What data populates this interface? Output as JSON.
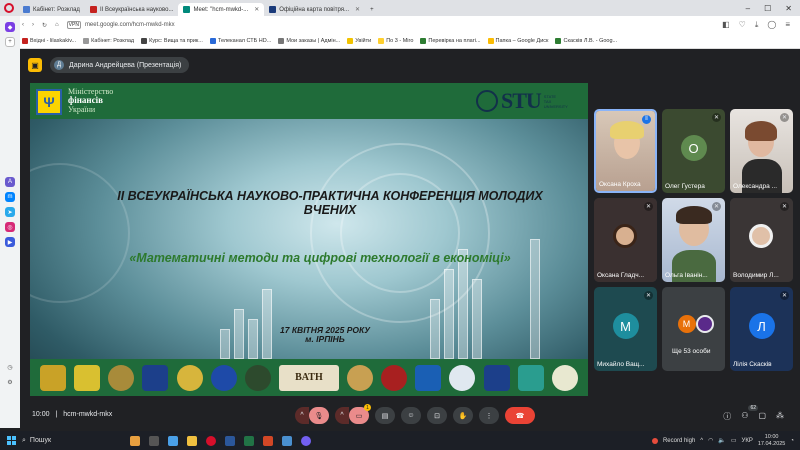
{
  "tabs": [
    {
      "label": "Кабінет: Розклад",
      "active": false
    },
    {
      "label": "II Всеукраїнська науково...",
      "active": false
    },
    {
      "label": "Meet: \"hcm-mwkd-...",
      "active": true
    },
    {
      "label": "Офіційна карта повітря...",
      "active": false
    }
  ],
  "address": {
    "vpn": "VPN",
    "url": "meet.google.com/hcm-mwkd-mkx"
  },
  "bookmarks": [
    "Вхідні - lilaskakiv...",
    "Кабінет: Розклад",
    "Курс: Вища та прик...",
    "Телеканал СТБ HD...",
    "Мои заказы | Адмін...",
    "Увійти",
    "По 3 - Miro",
    "Перевірка на плагі...",
    "Папка – Google Диск",
    "Скасків Л.В. - Goog..."
  ],
  "presenter": {
    "name": "Дарина Андрейцева (Презентація)",
    "initial": "Д"
  },
  "slide": {
    "ministry_line1": "Міністерство",
    "ministry_line2": "фінансів",
    "ministry_line3": "України",
    "stu_text": "STU",
    "stu_sub": "STATE\nTAX\nUNIVERSITY",
    "title": "II ВСЕУКРАЇНСЬКА НАУКОВО-ПРАКТИЧНА КОНФЕРЕНЦІЯ МОЛОДИХ ВЧЕНИХ",
    "subtitle": "«Математичні методи та цифрові технології в економіці»",
    "date": "17 КВІТНЯ 2025 РОКУ",
    "city": "м. ІРПІНЬ",
    "bath": "BATH"
  },
  "participants": [
    {
      "name": "Оксана Кроха",
      "type": "photo"
    },
    {
      "name": "Олег Густера",
      "initial": "О",
      "color": "#5f8a4f"
    },
    {
      "name": "Олександра ...",
      "type": "photo"
    },
    {
      "name": "Оксана Гладч...",
      "type": "photo"
    },
    {
      "name": "Ольга Іванін...",
      "type": "photo"
    },
    {
      "name": "Володимир Л...",
      "type": "photo"
    },
    {
      "name": "Михайло Ващ...",
      "initial": "М",
      "color": "#1e8e9e"
    },
    {
      "name": "Ще 53 особи",
      "initial": "М",
      "color": "#e8710a"
    },
    {
      "name": "Лілія Скасків",
      "initial": "Л",
      "color": "#1a73e8"
    }
  ],
  "meeting": {
    "time": "10:00",
    "code": "hcm-mwkd-mkx",
    "people_count": "62",
    "reactions_badge": "1"
  },
  "taskbar": {
    "search": "Пошук",
    "record": "Record high",
    "lang": "УКР",
    "time": "10:00",
    "date": "17.04.2025"
  },
  "colors": {
    "slide_green": "#1f6b3a",
    "end_call": "#ea4335",
    "meet_bg": "#202124"
  }
}
